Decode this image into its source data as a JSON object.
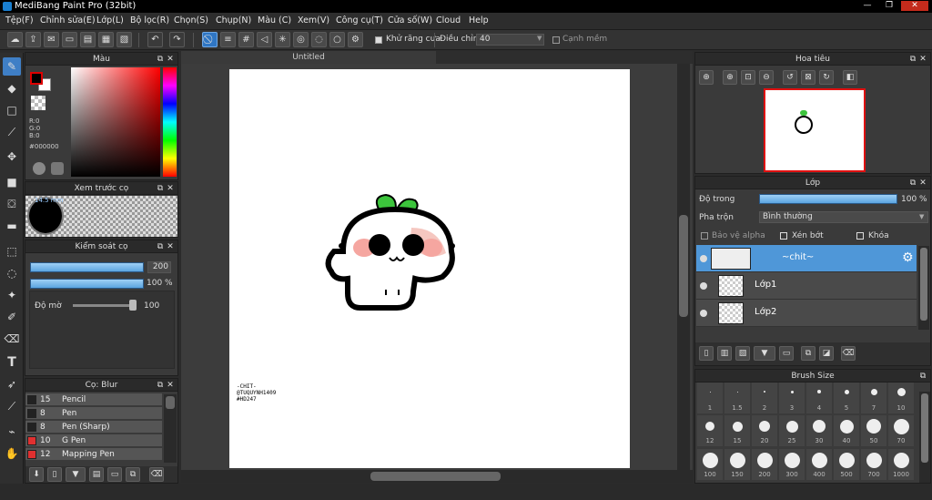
{
  "window": {
    "title": "MediBang Paint Pro (32bit)",
    "minimize": "—",
    "maximize": "❐",
    "close": "✕"
  },
  "menu": [
    "Tệp(F)",
    "Chỉnh sửa(E)",
    "Lớp(L)",
    "Bộ lọc(R)",
    "Chọn(S)",
    "Chụp(N)",
    "Màu (C)",
    "Xem(V)",
    "Công cụ(T)",
    "Cửa số(W)",
    "Cloud",
    "Help"
  ],
  "toolbar": {
    "antialias_label": "Khử răng cưa",
    "adjust_label": "Điều chỉnh",
    "adjust_value": "40",
    "edge_label": "Cạnh mềm"
  },
  "color_panel": {
    "title": "Màu",
    "r": "R:0",
    "g": "G:0",
    "b": "B:0",
    "hex": "#000000"
  },
  "brush_preview": {
    "title": "Xem trước cọ",
    "size": "14.5 mm"
  },
  "brush_control": {
    "title": "Kiểm soát cọ",
    "size_value": "200",
    "opacity_value": "100 %",
    "blur_label": "Độ mờ",
    "blur_value": "100"
  },
  "brush_list": {
    "title": "Cọ: Blur",
    "items": [
      {
        "n": "15",
        "label": "Pencil",
        "color": "#222222"
      },
      {
        "n": "8",
        "label": "Pen",
        "color": "#222222"
      },
      {
        "n": "8",
        "label": "Pen (Sharp)",
        "color": "#222222"
      },
      {
        "n": "10",
        "label": "G Pen",
        "color": "#e03030"
      },
      {
        "n": "12",
        "label": "Mapping Pen",
        "color": "#e03030"
      }
    ]
  },
  "canvas": {
    "tab": "Untitled",
    "signature": [
      "-CHIT-",
      "@TUQUYNH1409",
      "#HD247"
    ]
  },
  "navigator": {
    "title": "Hoa tiêu"
  },
  "layer_panel": {
    "title": "Lớp",
    "opacity_label": "Độ trong",
    "opacity_value": "100 %",
    "blend_label": "Pha trộn",
    "blend_value": "Bình thường",
    "protect_alpha": "Bảo vệ alpha",
    "clipping": "Xén bớt",
    "lock": "Khóa",
    "layers": [
      {
        "name": "~chit~",
        "selected": true
      },
      {
        "name": "Lớp1",
        "selected": false
      },
      {
        "name": "Lớp2",
        "selected": false
      }
    ]
  },
  "brush_size": {
    "title": "Brush Size",
    "rows": [
      [
        "1",
        "1.5",
        "2",
        "3",
        "4",
        "5",
        "7",
        "10"
      ],
      [
        "12",
        "15",
        "20",
        "25",
        "30",
        "40",
        "50",
        "70"
      ],
      [
        "100",
        "150",
        "200",
        "300",
        "400",
        "500",
        "700",
        "1000"
      ]
    ]
  }
}
